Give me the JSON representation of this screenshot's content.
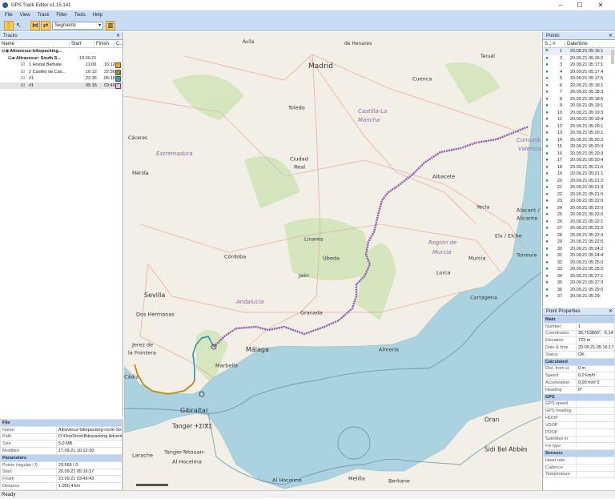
{
  "window": {
    "title": "GPS Track Editor v1.15.141",
    "minimize": "–",
    "maximize": "☐",
    "close": "✕"
  },
  "menu": [
    "File",
    "View",
    "Track",
    "Filter",
    "Tools",
    "Help"
  ],
  "toolbar": {
    "mode_select": "Segments"
  },
  "tracks_panel": {
    "title": "Tracks",
    "columns": [
      "Name",
      "Start",
      "Finish",
      "C..."
    ],
    "rows": [
      {
        "name": "Altravesur-bikepacking...",
        "start": "",
        "finish": "",
        "color": ""
      },
      {
        "name": "Altravesur: South S...",
        "start": "19.09.21",
        "finish": "",
        "color": ""
      },
      {
        "name": "1 Hostal Barbate",
        "start": "11:00",
        "finish": "16:12",
        "color": "#f0a800"
      },
      {
        "name": "2 Castillo de Cas...",
        "start": "16:12",
        "finish": "22:36",
        "color": "#a08a30"
      },
      {
        "name": "#1",
        "start": "22:36",
        "finish": "05:16",
        "color": "#3aa0b8"
      },
      {
        "name": "#1",
        "start": "05:16",
        "finish": "03:49",
        "color": "#f0b8e8"
      }
    ]
  },
  "file_props": {
    "sections": [
      {
        "title": "File",
        "rows": [
          [
            "Name",
            "Altravesur-bikepacking-route-Southern-Sp"
          ],
          [
            "Path",
            "D:\\OneDrive\\Bikepacking Adventures\\GPX"
          ],
          [
            "Size",
            "5,0 MB"
          ],
          [
            "Modified",
            "17.09.21 10:12:30"
          ]
        ]
      },
      {
        "title": "Parameters",
        "rows": [
          [
            "Points (regular / f)",
            "29.666 / 0"
          ],
          [
            "Start",
            "20.09.21 05:16:17"
          ],
          [
            "Finish",
            "23.09.21 03:49:43"
          ],
          [
            "Distance",
            "1.050,4 km"
          ]
        ]
      }
    ]
  },
  "points_panel": {
    "title": "Points",
    "columns": [
      "S...",
      "#",
      "Date/time"
    ],
    "rows": [
      [
        "1",
        "20.09.21",
        "05:16:1"
      ],
      [
        "2",
        "20.09.21",
        "05:16:2"
      ],
      [
        "3",
        "20.09.21",
        "05:17:1"
      ],
      [
        "4",
        "20.09.21",
        "05:17:4"
      ],
      [
        "5",
        "20.09.21",
        "05:17:5"
      ],
      [
        "6",
        "20.09.21",
        "05:18:1"
      ],
      [
        "7",
        "20.09.21",
        "05:18:3"
      ],
      [
        "8",
        "20.09.21",
        "05:18:5"
      ],
      [
        "9",
        "20.09.21",
        "05:19:1"
      ],
      [
        "10",
        "20.09.21",
        "05:19:3"
      ],
      [
        "11",
        "20.09.21",
        "05:19:4"
      ],
      [
        "12",
        "20.09.21",
        "05:20:1"
      ],
      [
        "13",
        "20.09.21",
        "05:20:1"
      ],
      [
        "14",
        "20.09.21",
        "05:20:2"
      ],
      [
        "15",
        "20.09.21",
        "05:20:3"
      ],
      [
        "16",
        "20.09.21",
        "05:20:3"
      ],
      [
        "17",
        "20.09.21",
        "05:20:4"
      ],
      [
        "18",
        "20.09.21",
        "05:21:0"
      ],
      [
        "19",
        "20.09.21",
        "05:21:1"
      ],
      [
        "20",
        "20.09.21",
        "05:21:2"
      ],
      [
        "21",
        "20.09.21",
        "05:21:3"
      ],
      [
        "22",
        "20.09.21",
        "05:21:5"
      ],
      [
        "23",
        "20.09.21",
        "05:22:0"
      ],
      [
        "24",
        "20.09.21",
        "05:22:0"
      ],
      [
        "25",
        "20.09.21",
        "05:22:0"
      ],
      [
        "26",
        "20.09.21",
        "05:22:1"
      ],
      [
        "27",
        "20.09.21",
        "05:22:2"
      ],
      [
        "28",
        "20.09.21",
        "05:22:3"
      ],
      [
        "29",
        "20.09.21",
        "05:22:5"
      ],
      [
        "30",
        "20.09.21",
        "05:24:2"
      ],
      [
        "31",
        "20.09.21",
        "05:24:4"
      ],
      [
        "32",
        "20.09.21",
        "05:25:0"
      ],
      [
        "33",
        "20.09.21",
        "05:25:2"
      ],
      [
        "34",
        "20.09.21",
        "05:27:1"
      ],
      [
        "35",
        "20.09.21",
        "05:27:3"
      ],
      [
        "36",
        "20.09.21",
        "05:29:0"
      ],
      [
        "37",
        "20.09.21",
        "05:29:"
      ]
    ]
  },
  "point_props": {
    "title": "Point Properties",
    "sections": [
      {
        "title": "Main",
        "rows": [
          [
            "Number",
            "1"
          ],
          [
            "Coordinates",
            "36,753860°, -5,147760°"
          ],
          [
            "Elevation",
            "723 m"
          ],
          [
            "Date & time",
            "20.09.21 05:16:17.00"
          ],
          [
            "Status",
            "OK"
          ]
        ]
      },
      {
        "title": "Calculated",
        "rows": [
          [
            "Dist. from st",
            "0 m"
          ],
          [
            "Speed",
            "0,0 km/h"
          ],
          [
            "Acceleration",
            "0,00 m/s^2"
          ],
          [
            "Heading",
            "0°"
          ]
        ]
      },
      {
        "title": "GPS",
        "rows": [
          [
            "GPS speed",
            ""
          ],
          [
            "GPS heading",
            ""
          ],
          [
            "HDOP",
            ""
          ],
          [
            "VDOP",
            ""
          ],
          [
            "PDOP",
            ""
          ],
          [
            "Satellites in",
            ""
          ],
          [
            "Fix type",
            ""
          ]
        ]
      },
      {
        "title": "Sensors",
        "rows": [
          [
            "Heart rate",
            ""
          ],
          [
            "Cadence",
            ""
          ],
          [
            "Temperature",
            ""
          ]
        ]
      }
    ]
  },
  "map": {
    "labels": [
      [
        "Ávila",
        148,
        8,
        6
      ],
      [
        "de Henares",
        275,
        10,
        6
      ],
      [
        "Madrid",
        230,
        36,
        9
      ],
      [
        "Teruel",
        445,
        26,
        6
      ],
      [
        "Cuenca",
        360,
        54,
        6.5
      ],
      [
        "Toledo",
        205,
        90,
        6.5
      ],
      [
        "Castilla-La",
        292,
        94,
        7
      ],
      [
        "Mancha",
        292,
        105,
        7
      ],
      [
        "Extremadura",
        40,
        147,
        7
      ],
      [
        "Cáceres",
        5,
        128,
        6
      ],
      [
        "Mérida",
        10,
        172,
        6
      ],
      [
        "Ciudad",
        207,
        154,
        6.5
      ],
      [
        "Real",
        212,
        164,
        6.5
      ],
      [
        "Albacete",
        385,
        176,
        6.5
      ],
      [
        "Comunitat",
        490,
        130,
        7
      ],
      [
        "Valenciana",
        492,
        141,
        7
      ],
      [
        "Yecla",
        440,
        214,
        6.5
      ],
      [
        "Alacant /",
        490,
        218,
        6.5
      ],
      [
        "Alicante",
        490,
        228,
        6.5
      ],
      [
        "Elx / Elche",
        463,
        250,
        6.5
      ],
      [
        "Región de",
        380,
        258,
        7
      ],
      [
        "Murcia",
        385,
        270,
        7
      ],
      [
        "Murcia",
        430,
        278,
        6.5
      ],
      [
        "Torrevie",
        490,
        274,
        6.5
      ],
      [
        "Linares",
        225,
        254,
        6.5
      ],
      [
        "Córdoba",
        125,
        276,
        6.5
      ],
      [
        "Úbeda",
        248,
        278,
        6.5
      ],
      [
        "Lorca",
        390,
        296,
        6.5
      ],
      [
        "Jaén",
        218,
        300,
        6
      ],
      [
        "Sevilla",
        25,
        323,
        8
      ],
      [
        "Cartagena",
        432,
        327,
        6.5
      ],
      [
        "Andalucía",
        140,
        332,
        7
      ],
      [
        "Dos Hermanas",
        15,
        348,
        6.5
      ],
      [
        "Granada",
        220,
        346,
        6.5
      ],
      [
        "Jerez de",
        10,
        386,
        6.5
      ],
      [
        "la Frontera",
        5,
        396,
        6.5
      ],
      [
        "Málaga",
        152,
        391,
        8
      ],
      [
        "Almería",
        318,
        392,
        6.5
      ],
      [
        "Marbella",
        114,
        412,
        6.5
      ],
      [
        "Cádiz",
        0,
        426,
        6.5
      ],
      [
        "Gibraltar",
        70,
        467,
        8
      ],
      [
        "Tanger ⵜⵉⵏⴳⵉ",
        60,
        487,
        7.5
      ],
      [
        "Oran",
        450,
        479,
        7.5
      ],
      [
        "Sidi Bel Abbès",
        450,
        516,
        7.5
      ],
      [
        "Larache",
        10,
        524,
        6.5
      ],
      [
        "Tanger-Tétouan-",
        50,
        520,
        6.5
      ],
      [
        "Al Hoceima",
        60,
        532,
        6.5
      ],
      [
        "Al Hoceima",
        185,
        555,
        6.5
      ],
      [
        "Melilla",
        280,
        553,
        6.5
      ],
      [
        "Berkane",
        330,
        556,
        6.5
      ]
    ]
  }
}
